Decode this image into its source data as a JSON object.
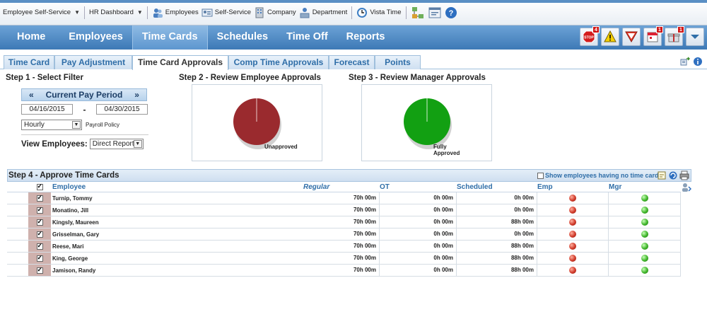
{
  "toolbar": {
    "items": [
      {
        "label": "Employee Self-Service",
        "icon": "",
        "has_caret": true
      },
      {
        "label": "HR Dashboard",
        "icon": "",
        "has_caret": true
      },
      {
        "label": "Employees",
        "icon": "employees-icon",
        "has_caret": false
      },
      {
        "label": "Self-Service",
        "icon": "id-card-icon",
        "has_caret": false
      },
      {
        "label": "Company",
        "icon": "building-icon",
        "has_caret": false
      },
      {
        "label": "Department",
        "icon": "department-icon",
        "has_caret": false
      },
      {
        "label": "Vista Time",
        "icon": "clock-icon",
        "has_caret": false
      }
    ]
  },
  "nav": {
    "items": [
      "Home",
      "Employees",
      "Time Cards",
      "Schedules",
      "Time Off",
      "Reports"
    ],
    "active": "Time Cards",
    "alerts": [
      {
        "icon": "stop-icon",
        "badge": "4"
      },
      {
        "icon": "warning-icon",
        "badge": ""
      },
      {
        "icon": "down-triangle-icon",
        "badge": ""
      },
      {
        "icon": "calendar-icon",
        "badge": "1"
      },
      {
        "icon": "gift-icon",
        "badge": "1"
      },
      {
        "icon": "chevron-down-icon",
        "badge": ""
      }
    ]
  },
  "subtabs": {
    "items": [
      "Time Card",
      "Pay Adjustment",
      "Time Card Approvals",
      "Comp Time Approvals",
      "Forecast",
      "Points"
    ],
    "active": "Time Card Approvals"
  },
  "step1": {
    "title": "Step 1 - Select Filter",
    "prev": "«",
    "period": "Current Pay Period",
    "next": "»",
    "start_date": "04/16/2015",
    "dash": "-",
    "end_date": "04/30/2015",
    "policy_value": "Hourly",
    "policy_label": "Payroll Policy",
    "view_label": "View Employees:",
    "view_value": "Direct Reports"
  },
  "step2": {
    "title": "Step 2 - Review Employee Approvals",
    "label": "Unapproved",
    "color": "#9a2a2e"
  },
  "step3": {
    "title": "Step 3 - Review Manager Approvals",
    "label_line1": "Fully",
    "label_line2": "Approved",
    "color": "#12a012"
  },
  "step4": {
    "title": "Step 4 - Approve Time Cards",
    "show_empty_label": "Show employees having no time cards",
    "columns": {
      "employee": "Employee",
      "regular": "Regular",
      "ot": "OT",
      "scheduled": "Scheduled",
      "emp": "Emp",
      "mgr": "Mgr"
    },
    "rows": [
      {
        "name": "Turnip, Tommy",
        "regular": "70h 00m",
        "ot": "0h 00m",
        "scheduled": "0h 00m",
        "emp": "red",
        "mgr": "green"
      },
      {
        "name": "Monatino, Jill",
        "regular": "70h 00m",
        "ot": "0h 00m",
        "scheduled": "0h 00m",
        "emp": "red",
        "mgr": "green"
      },
      {
        "name": "Kingsly, Maureen",
        "regular": "70h 00m",
        "ot": "0h 00m",
        "scheduled": "88h 00m",
        "emp": "red",
        "mgr": "green"
      },
      {
        "name": "Grisselman, Gary",
        "regular": "70h 00m",
        "ot": "0h 00m",
        "scheduled": "0h 00m",
        "emp": "red",
        "mgr": "green"
      },
      {
        "name": "Reese, Mari",
        "regular": "70h 00m",
        "ot": "0h 00m",
        "scheduled": "88h 00m",
        "emp": "red",
        "mgr": "green"
      },
      {
        "name": "King, George",
        "regular": "70h 00m",
        "ot": "0h 00m",
        "scheduled": "88h 00m",
        "emp": "red",
        "mgr": "green"
      },
      {
        "name": "Jamison, Randy",
        "regular": "70h 00m",
        "ot": "0h 00m",
        "scheduled": "88h 00m",
        "emp": "red",
        "mgr": "green"
      }
    ]
  }
}
